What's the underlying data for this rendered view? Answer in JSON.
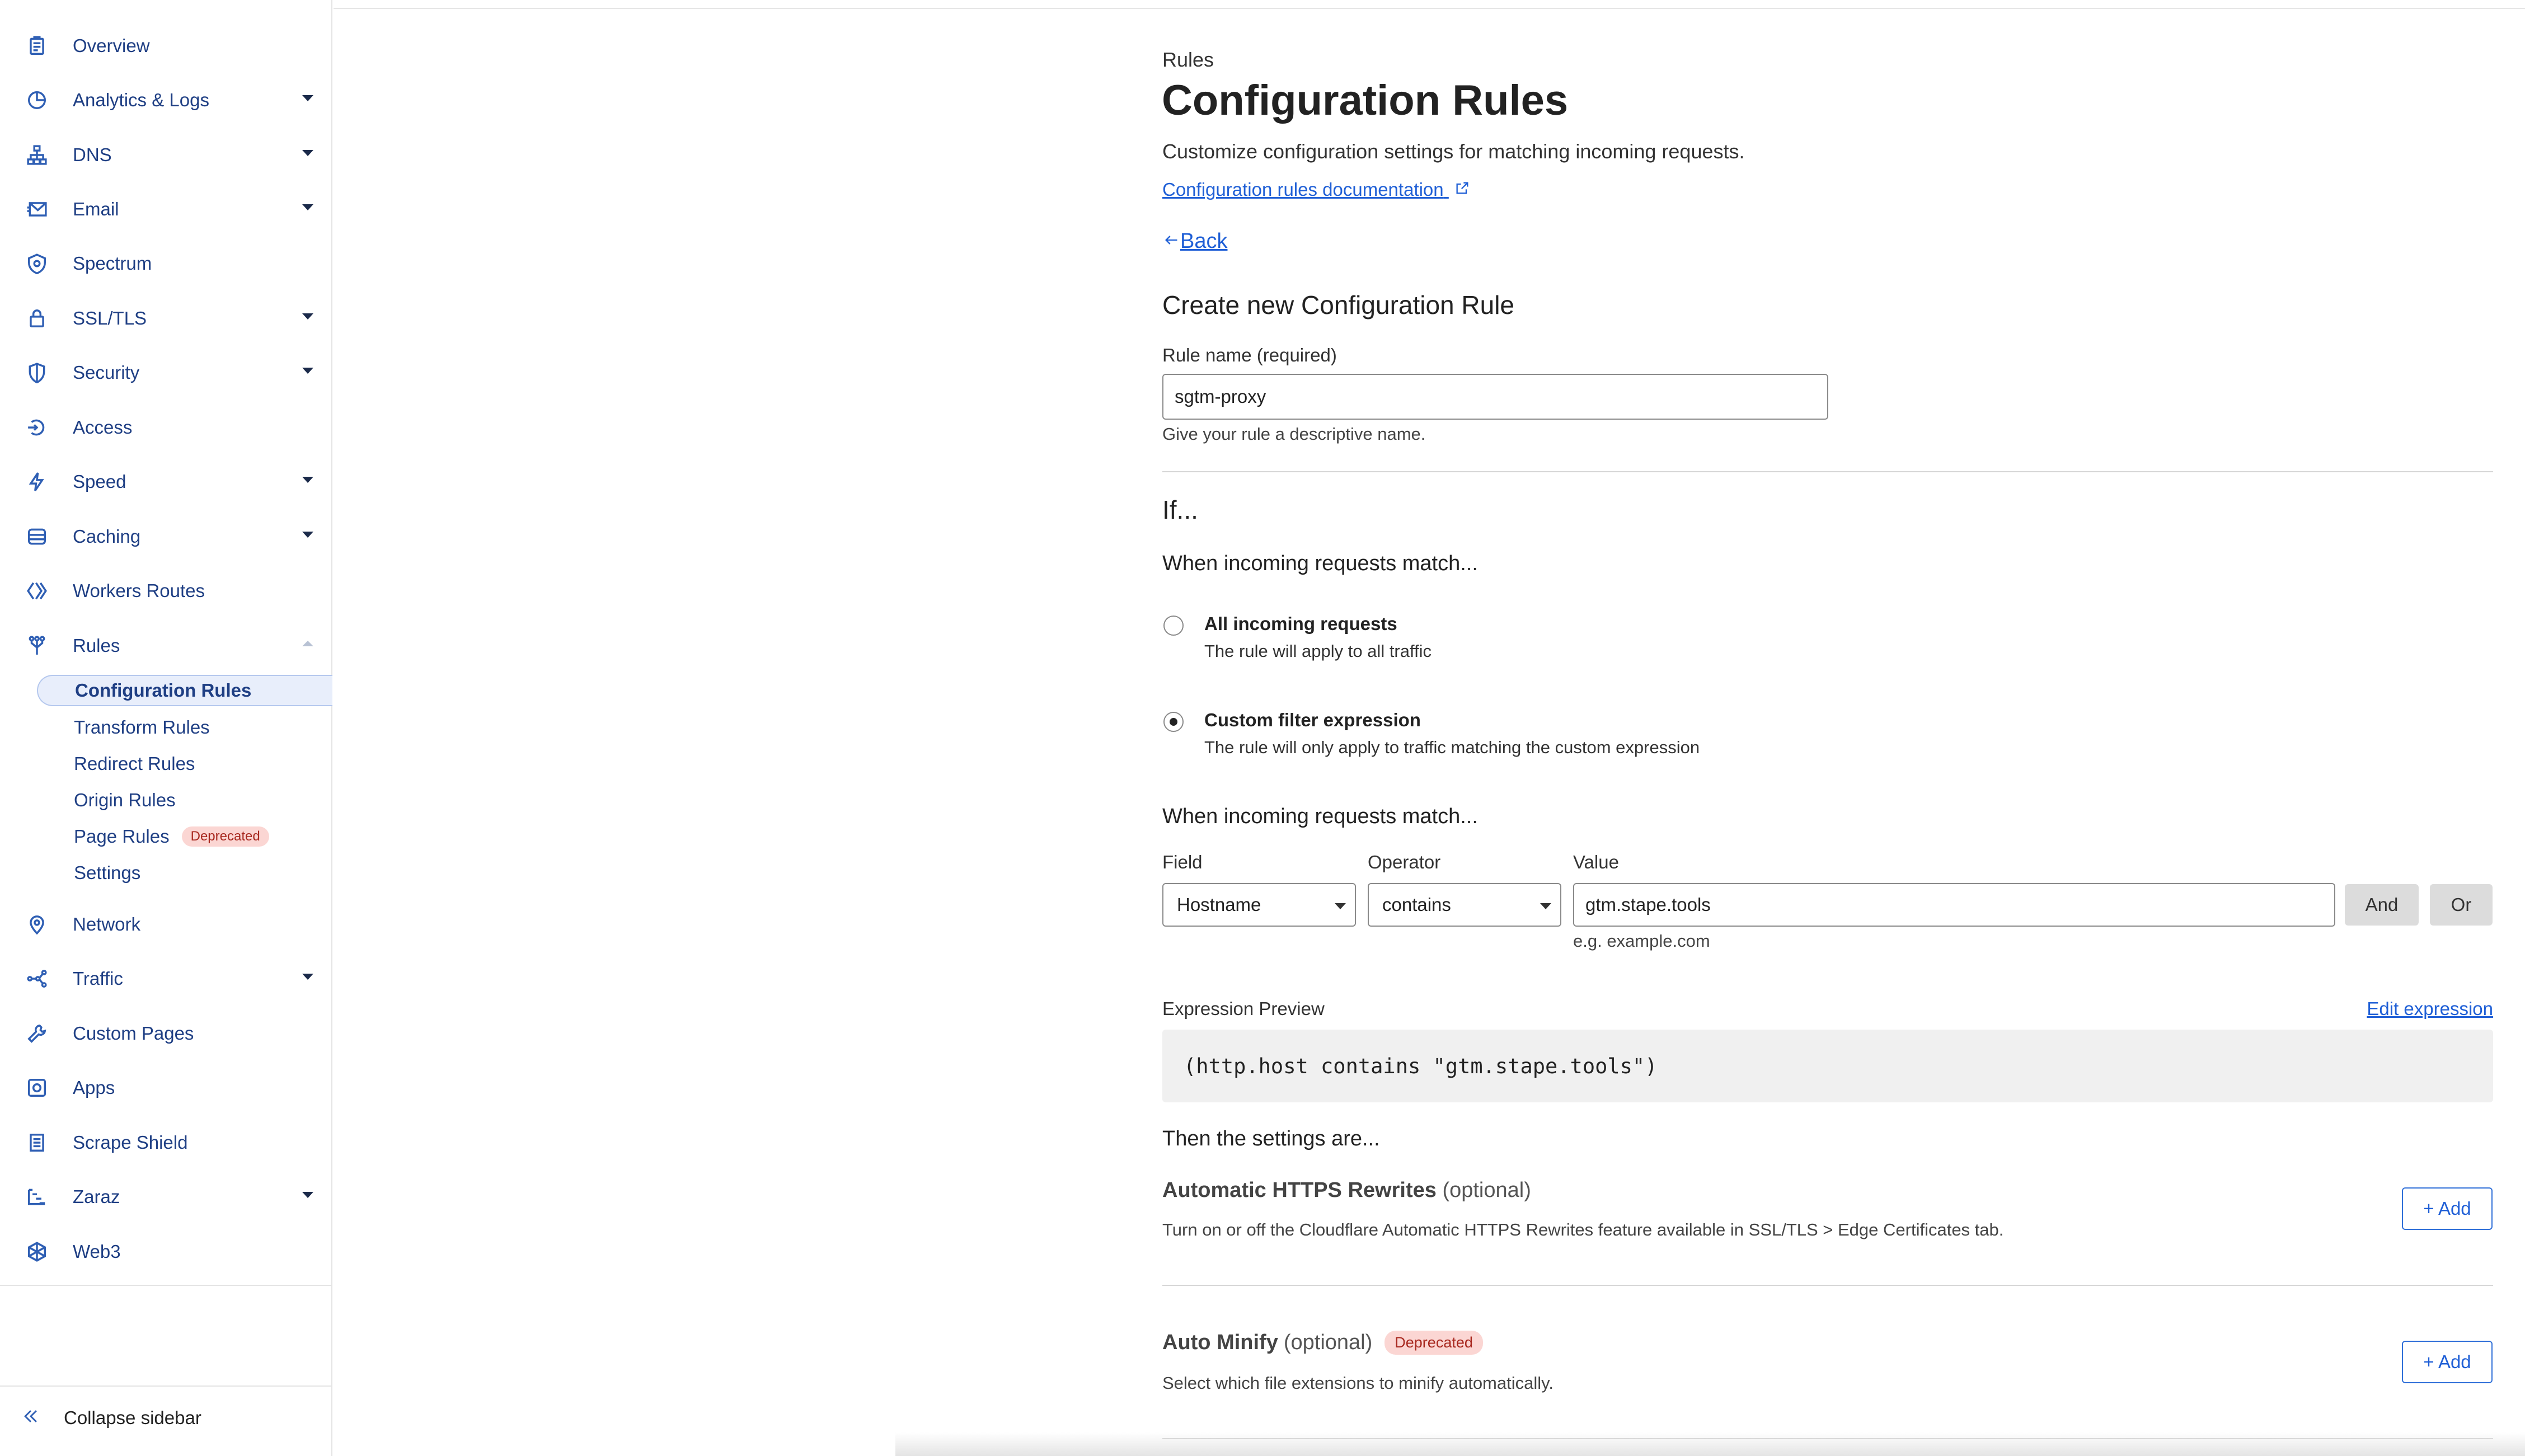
{
  "sidebar": {
    "items": [
      {
        "label": "Overview",
        "icon": "clipboard-icon",
        "caret": false
      },
      {
        "label": "Analytics & Logs",
        "icon": "pie-chart-icon",
        "caret": true
      },
      {
        "label": "DNS",
        "icon": "network-tree-icon",
        "caret": true
      },
      {
        "label": "Email",
        "icon": "mail-icon",
        "caret": true
      },
      {
        "label": "Spectrum",
        "icon": "shield-gear-icon",
        "caret": false
      },
      {
        "label": "SSL/TLS",
        "icon": "lock-icon",
        "caret": true
      },
      {
        "label": "Security",
        "icon": "shield-icon",
        "caret": true
      },
      {
        "label": "Access",
        "icon": "access-icon",
        "caret": false
      },
      {
        "label": "Speed",
        "icon": "lightning-icon",
        "caret": true
      },
      {
        "label": "Caching",
        "icon": "database-icon",
        "caret": true
      },
      {
        "label": "Workers Routes",
        "icon": "workers-icon",
        "caret": false
      },
      {
        "label": "Rules",
        "icon": "fork-icon",
        "caret": "up"
      }
    ],
    "rules_sub": [
      {
        "label": "Configuration Rules",
        "active": true
      },
      {
        "label": "Transform Rules"
      },
      {
        "label": "Redirect Rules"
      },
      {
        "label": "Origin Rules"
      },
      {
        "label": "Page Rules",
        "badge": "Deprecated"
      },
      {
        "label": "Settings"
      }
    ],
    "items_after": [
      {
        "label": "Network",
        "icon": "location-pin-icon",
        "caret": false
      },
      {
        "label": "Traffic",
        "icon": "share-nodes-icon",
        "caret": true
      },
      {
        "label": "Custom Pages",
        "icon": "wrench-icon",
        "caret": false
      },
      {
        "label": "Apps",
        "icon": "apps-icon",
        "caret": false
      },
      {
        "label": "Scrape Shield",
        "icon": "document-icon",
        "caret": false
      },
      {
        "label": "Zaraz",
        "icon": "zaraz-icon",
        "caret": true
      },
      {
        "label": "Web3",
        "icon": "web3-icon",
        "caret": false
      }
    ],
    "collapse_label": "Collapse sidebar"
  },
  "page": {
    "breadcrumb": "Rules",
    "title": "Configuration Rules",
    "description": "Customize configuration settings for matching incoming requests.",
    "doc_link": "Configuration rules documentation",
    "back_label": "Back",
    "form_title": "Create new Configuration Rule",
    "rule_name_label": "Rule name (required)",
    "rule_name_value": "sgtm-proxy",
    "rule_name_hint": "Give your rule a descriptive name.",
    "if_title": "If...",
    "match_heading": "When incoming requests match...",
    "option_all_title": "All incoming requests",
    "option_all_desc": "The rule will apply to all traffic",
    "option_custom_title": "Custom filter expression",
    "option_custom_desc": "The rule will only apply to traffic matching the custom expression",
    "match_heading_2": "When incoming requests match...",
    "field_label": "Field",
    "operator_label": "Operator",
    "value_label": "Value",
    "field_value": "Hostname",
    "operator_value": "contains",
    "value_value": "gtm.stape.tools",
    "value_hint": "e.g. example.com",
    "and_label": "And",
    "or_label": "Or",
    "expr_preview_label": "Expression Preview",
    "edit_expression": "Edit expression",
    "expression": "(http.host contains \"gtm.stape.tools\")",
    "then_heading": "Then the settings are...",
    "setting1_title": "Automatic HTTPS Rewrites",
    "setting1_optional": "(optional)",
    "setting1_desc": "Turn on or off the Cloudflare Automatic HTTPS Rewrites feature available in SSL/TLS > Edge Certificates tab.",
    "setting2_title": "Auto Minify",
    "setting2_optional": "(optional)",
    "setting2_badge": "Deprecated",
    "setting2_desc": "Select which file extensions to minify automatically.",
    "add_label": "+ Add"
  }
}
